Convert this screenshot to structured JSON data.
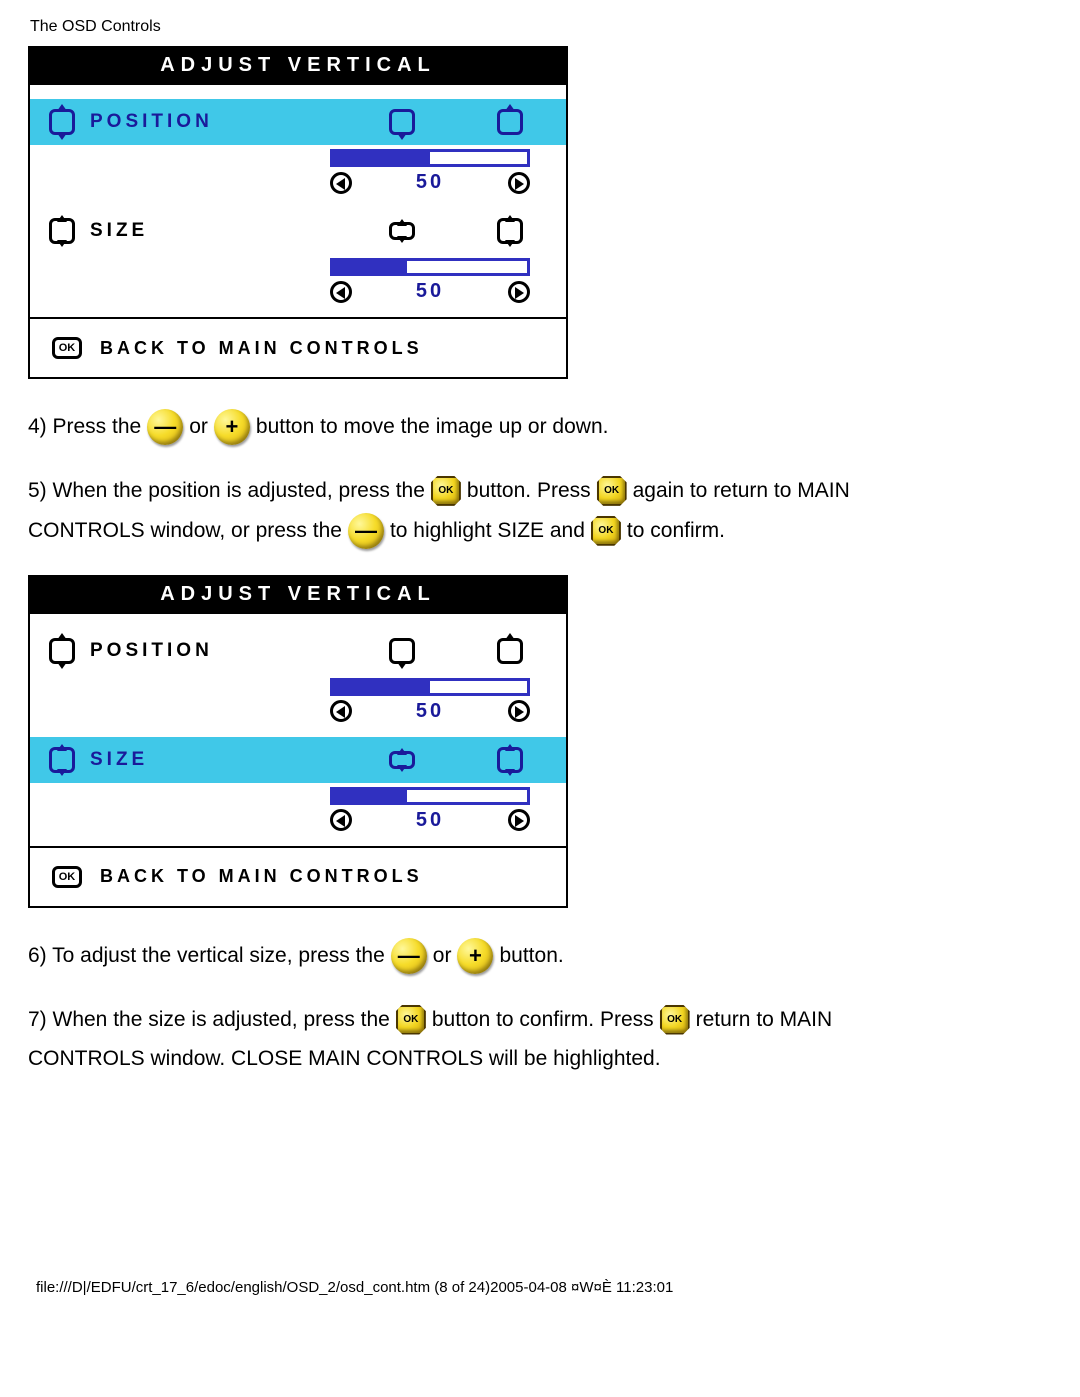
{
  "page_header": "The OSD Controls",
  "osd1": {
    "title": "ADJUST VERTICAL",
    "position_label": "POSITION",
    "position_value": "50",
    "position_fill_pct": 50,
    "size_label": "SIZE",
    "size_value": "50",
    "size_fill_pct": 38,
    "back_label": "BACK TO MAIN CONTROLS",
    "ok_text": "OK",
    "highlighted": "position"
  },
  "osd2": {
    "title": "ADJUST VERTICAL",
    "position_label": "POSITION",
    "position_value": "50",
    "position_fill_pct": 50,
    "size_label": "SIZE",
    "size_value": "50",
    "size_fill_pct": 38,
    "back_label": "BACK TO MAIN CONTROLS",
    "ok_text": "OK",
    "highlighted": "size"
  },
  "step4": {
    "a": "4) Press the",
    "b": "or",
    "c": "button to move the image up or down."
  },
  "step5": {
    "a": "5) When the position is adjusted, press the",
    "b": "button. Press",
    "c": "again to return to MAIN",
    "d": "CONTROLS window, or press the",
    "e": "to highlight SIZE and",
    "f": "to confirm."
  },
  "step6": {
    "a": "6) To adjust the vertical size, press the",
    "b": "or",
    "c": "button."
  },
  "step7": {
    "a": "7) When the size is adjusted, press the",
    "b": "button to confirm. Press",
    "c": "return to MAIN",
    "d": "CONTROLS window. CLOSE MAIN CONTROLS will be highlighted."
  },
  "buttons": {
    "minus": "—",
    "plus": "+",
    "ok": "OK"
  },
  "footer": "file:///D|/EDFU/crt_17_6/edoc/english/OSD_2/osd_cont.htm (8 of 24)2005-04-08 ¤W¤È 11:23:01"
}
